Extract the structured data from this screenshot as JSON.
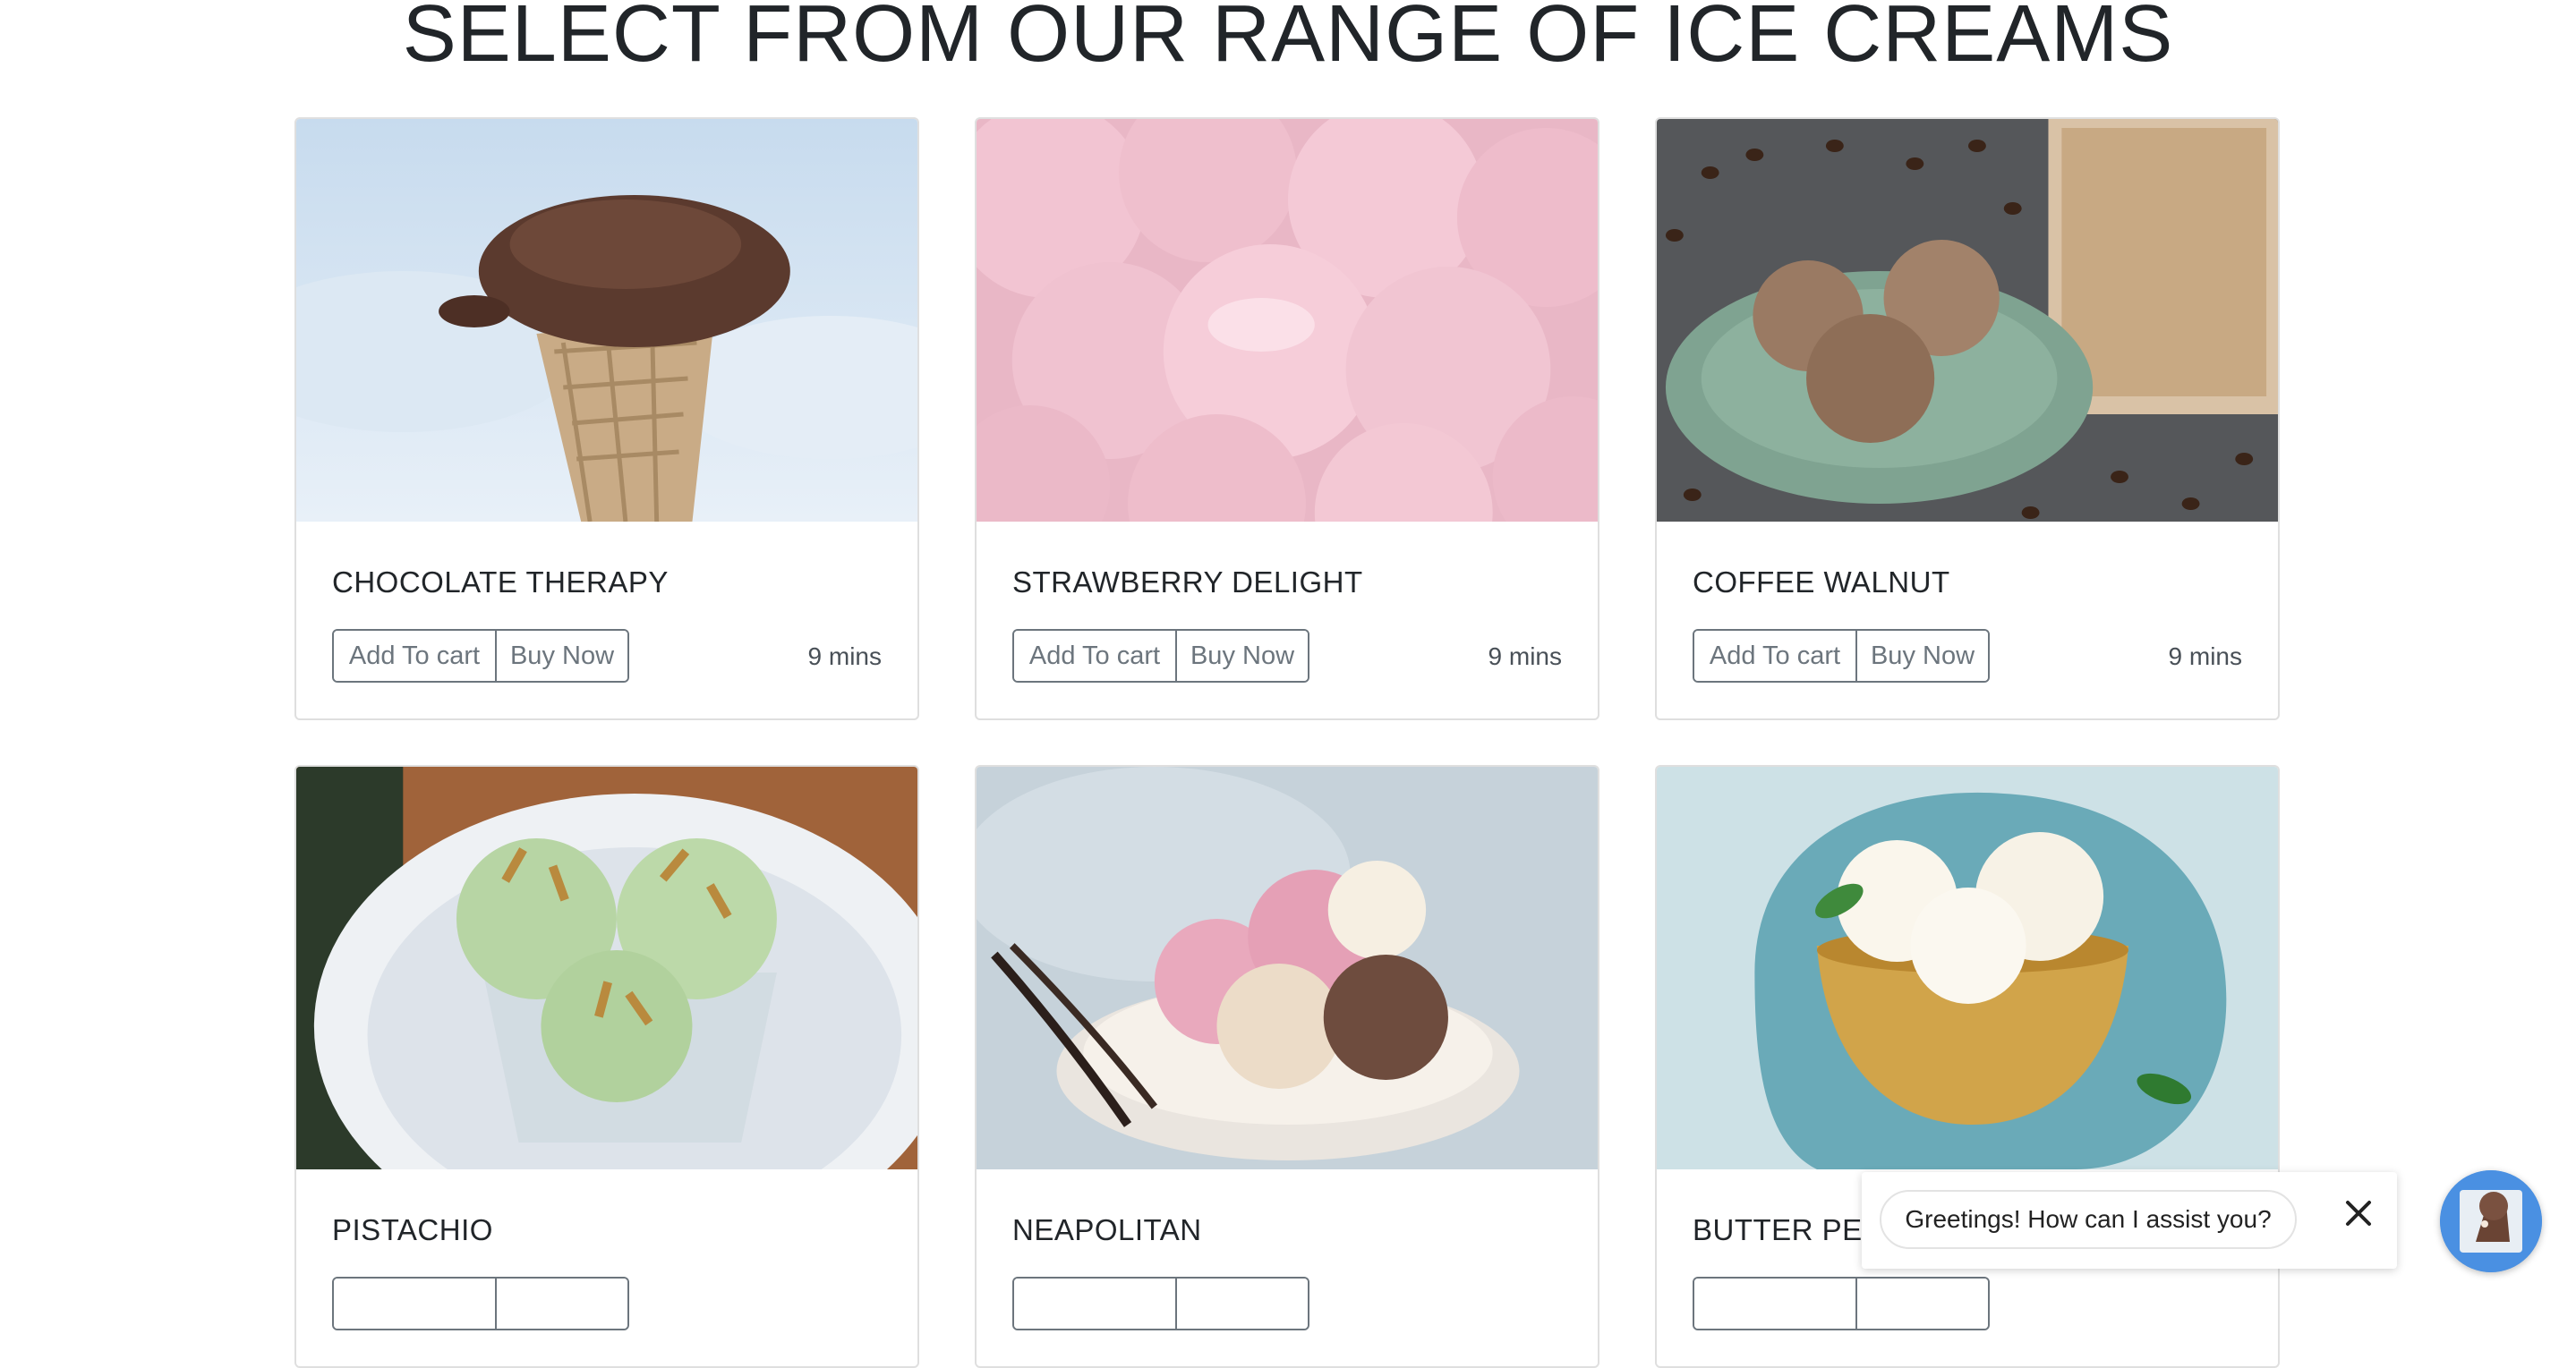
{
  "page": {
    "title": "SELECT FROM OUR RANGE OF ICE CREAMS"
  },
  "products": [
    {
      "name": "CHOCOLATE THERAPY",
      "add_label": "Add To cart",
      "buy_label": "Buy Now",
      "time": "9 mins"
    },
    {
      "name": "STRAWBERRY DELIGHT",
      "add_label": "Add To cart",
      "buy_label": "Buy Now",
      "time": "9 mins"
    },
    {
      "name": "COFFEE WALNUT",
      "add_label": "Add To cart",
      "buy_label": "Buy Now",
      "time": "9 mins"
    },
    {
      "name": "PISTACHIO"
    },
    {
      "name": "NEAPOLITAN"
    },
    {
      "name": "BUTTER PEC"
    }
  ],
  "chat": {
    "greeting": "Greetings! How can I assist you?",
    "close_icon": "close-icon",
    "launcher_icon": "chatbot-avatar-icon"
  },
  "colors": {
    "text": "#212529",
    "button_border": "#6c757d",
    "card_border": "#dfdfdf",
    "chat_launcher": "#4a90e2"
  }
}
